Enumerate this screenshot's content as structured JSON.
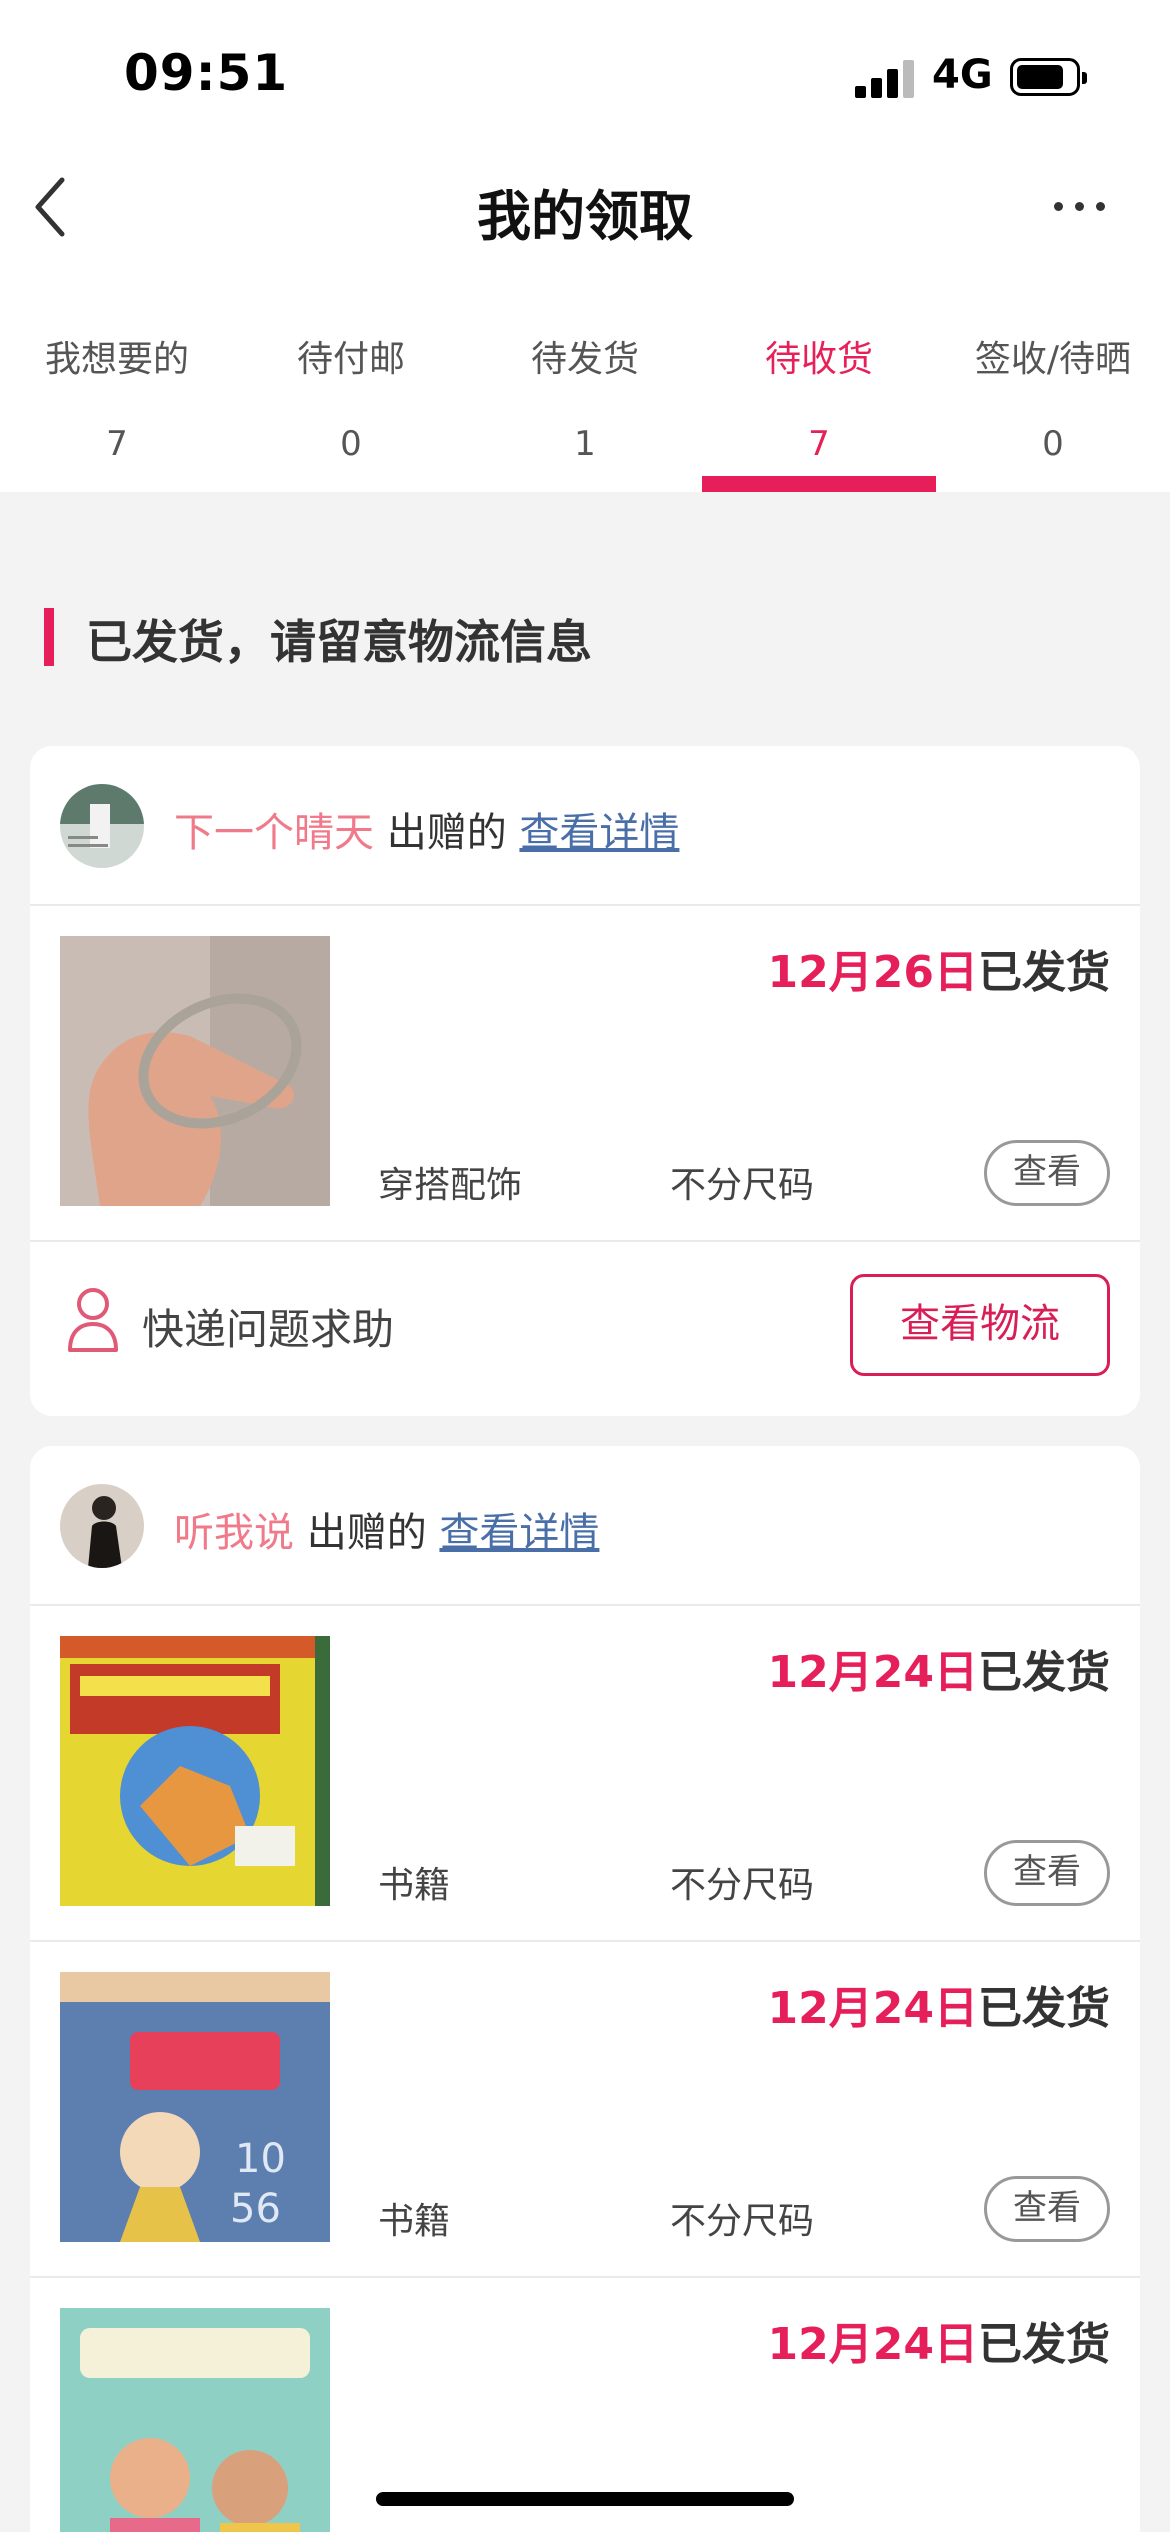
{
  "status_bar": {
    "time": "09:51",
    "network": "4G"
  },
  "nav": {
    "title": "我的领取"
  },
  "tabs": [
    {
      "label": "我想要的",
      "count": "7"
    },
    {
      "label": "待付邮",
      "count": "0"
    },
    {
      "label": "待发货",
      "count": "1"
    },
    {
      "label": "待收货",
      "count": "7",
      "active": true
    },
    {
      "label": "签收/待晒",
      "count": "0"
    }
  ],
  "section": {
    "title": "已发货，请留意物流信息"
  },
  "cards": [
    {
      "giver": "下一个晴天",
      "gift_label": "出赠的",
      "detail_link": "查看详情",
      "items": [
        {
          "date": "12月26日",
          "status": "已发货",
          "category": "穿搭配饰",
          "size": "不分尺码",
          "view": "查看"
        }
      ],
      "help_text": "快递问题求助",
      "logistics_button": "查看物流"
    },
    {
      "giver": "听我说",
      "gift_label": "出赠的",
      "detail_link": "查看详情",
      "items": [
        {
          "date": "12月24日",
          "status": "已发货",
          "category": "书籍",
          "size": "不分尺码",
          "view": "查看"
        },
        {
          "date": "12月24日",
          "status": "已发货",
          "category": "书籍",
          "size": "不分尺码",
          "view": "查看"
        },
        {
          "date": "12月24日",
          "status": "已发货"
        }
      ]
    }
  ],
  "colors": {
    "accent": "#e61e5a",
    "giver": "#f07a8a",
    "link": "#4a6fa8"
  },
  "icons": [
    "back-icon",
    "more-icon",
    "signal-icon",
    "battery-icon",
    "person-icon"
  ]
}
